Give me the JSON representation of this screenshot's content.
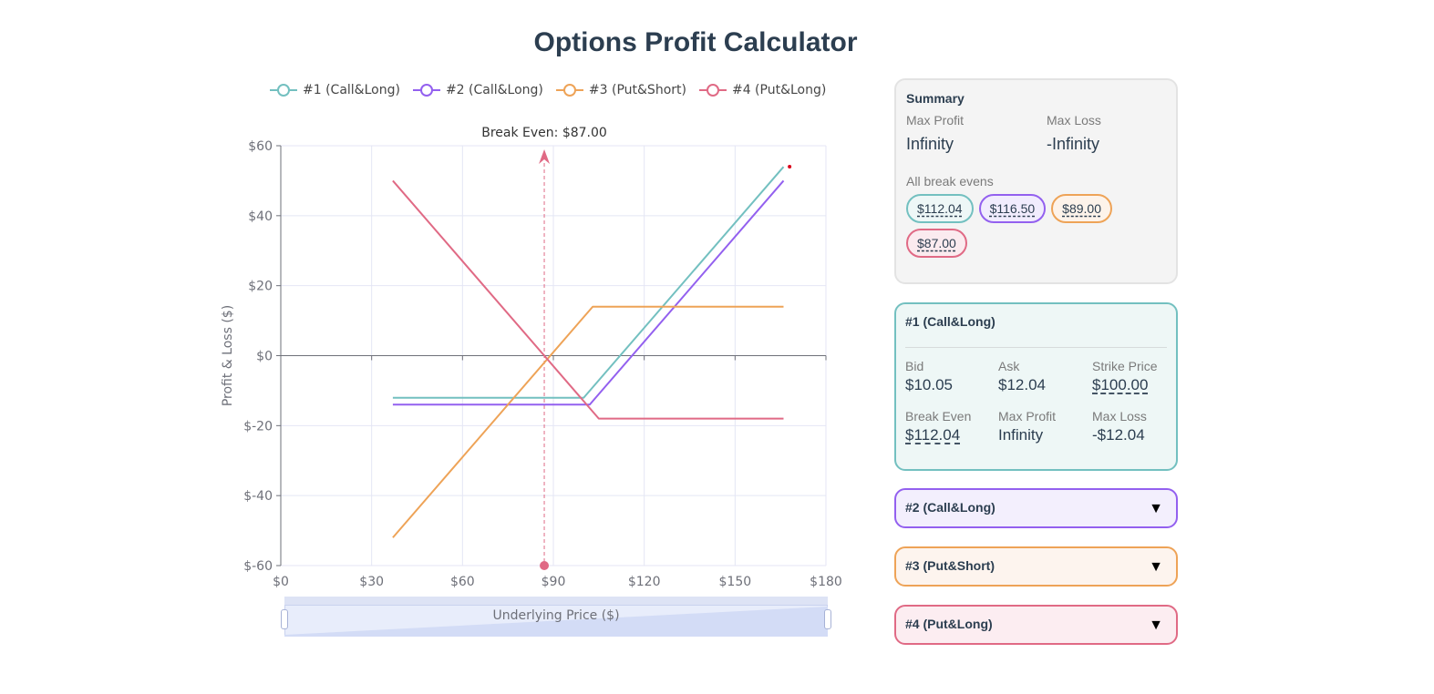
{
  "page": {
    "title": "Options Profit Calculator"
  },
  "colors": {
    "c1": "#73c0c0",
    "c2": "#9360ef",
    "c3": "#eea357",
    "c4": "#e06a85",
    "grid": "#e4e6f4",
    "axis": "#6e7079"
  },
  "legend": [
    {
      "label": "#1 (Call&Long)",
      "color": "#73c0c0"
    },
    {
      "label": "#2 (Call&Long)",
      "color": "#9360ef"
    },
    {
      "label": "#3 (Put&Short)",
      "color": "#eea357"
    },
    {
      "label": "#4 (Put&Long)",
      "color": "#e06a85"
    }
  ],
  "chart_data": {
    "type": "line",
    "xlabel": "Underlying Price ($)",
    "ylabel": "Profit & Loss ($)",
    "xlim": [
      0,
      180
    ],
    "ylim": [
      -60,
      60
    ],
    "x_ticks": [
      "$0",
      "$30",
      "$60",
      "$90",
      "$120",
      "$150",
      "$180"
    ],
    "y_ticks": [
      "$60",
      "$40",
      "$20",
      "$0",
      "$-20",
      "$-40",
      "$-60"
    ],
    "grid": true,
    "legend_position": "top",
    "series": [
      {
        "name": "#1 (Call&Long)",
        "color": "#73c0c0",
        "x": [
          37,
          100,
          166
        ],
        "y": [
          -12.04,
          -12.04,
          53.96
        ]
      },
      {
        "name": "#2 (Call&Long)",
        "color": "#9360ef",
        "x": [
          37,
          102,
          166
        ],
        "y": [
          -14.0,
          -14.0,
          50.0
        ]
      },
      {
        "name": "#3 (Put&Short)",
        "color": "#eea357",
        "x": [
          37,
          103,
          166
        ],
        "y": [
          -52.0,
          14.0,
          14.0
        ]
      },
      {
        "name": "#4 (Put&Long)",
        "color": "#e06a85",
        "x": [
          37,
          105,
          166
        ],
        "y": [
          50.0,
          -18.0,
          -18.0
        ]
      }
    ],
    "annotation": {
      "label": "Break Even: $87.00",
      "x": 87
    }
  },
  "zoom": {
    "label": "Underlying Price ($)"
  },
  "summary": {
    "title": "Summary",
    "max_profit_label": "Max Profit",
    "max_profit": "Infinity",
    "max_loss_label": "Max Loss",
    "max_loss": "-Infinity",
    "break_evens_label": "All break evens",
    "break_evens": [
      "$112.04",
      "$116.50",
      "$89.00",
      "$87.00"
    ]
  },
  "cards": [
    {
      "title": "#1 (Call&Long)",
      "bid_label": "Bid",
      "bid": "$10.05",
      "ask_label": "Ask",
      "ask": "$12.04",
      "strike_label": "Strike Price",
      "strike": "$100.00",
      "be_label": "Break Even",
      "be": "$112.04",
      "maxp_label": "Max Profit",
      "maxp": "Infinity",
      "maxl_label": "Max Loss",
      "maxl": "-$12.04"
    },
    {
      "title": "#2 (Call&Long)",
      "toggle": "▼"
    },
    {
      "title": "#3 (Put&Short)",
      "toggle": "▼"
    },
    {
      "title": "#4 (Put&Long)",
      "toggle": "▼"
    }
  ]
}
